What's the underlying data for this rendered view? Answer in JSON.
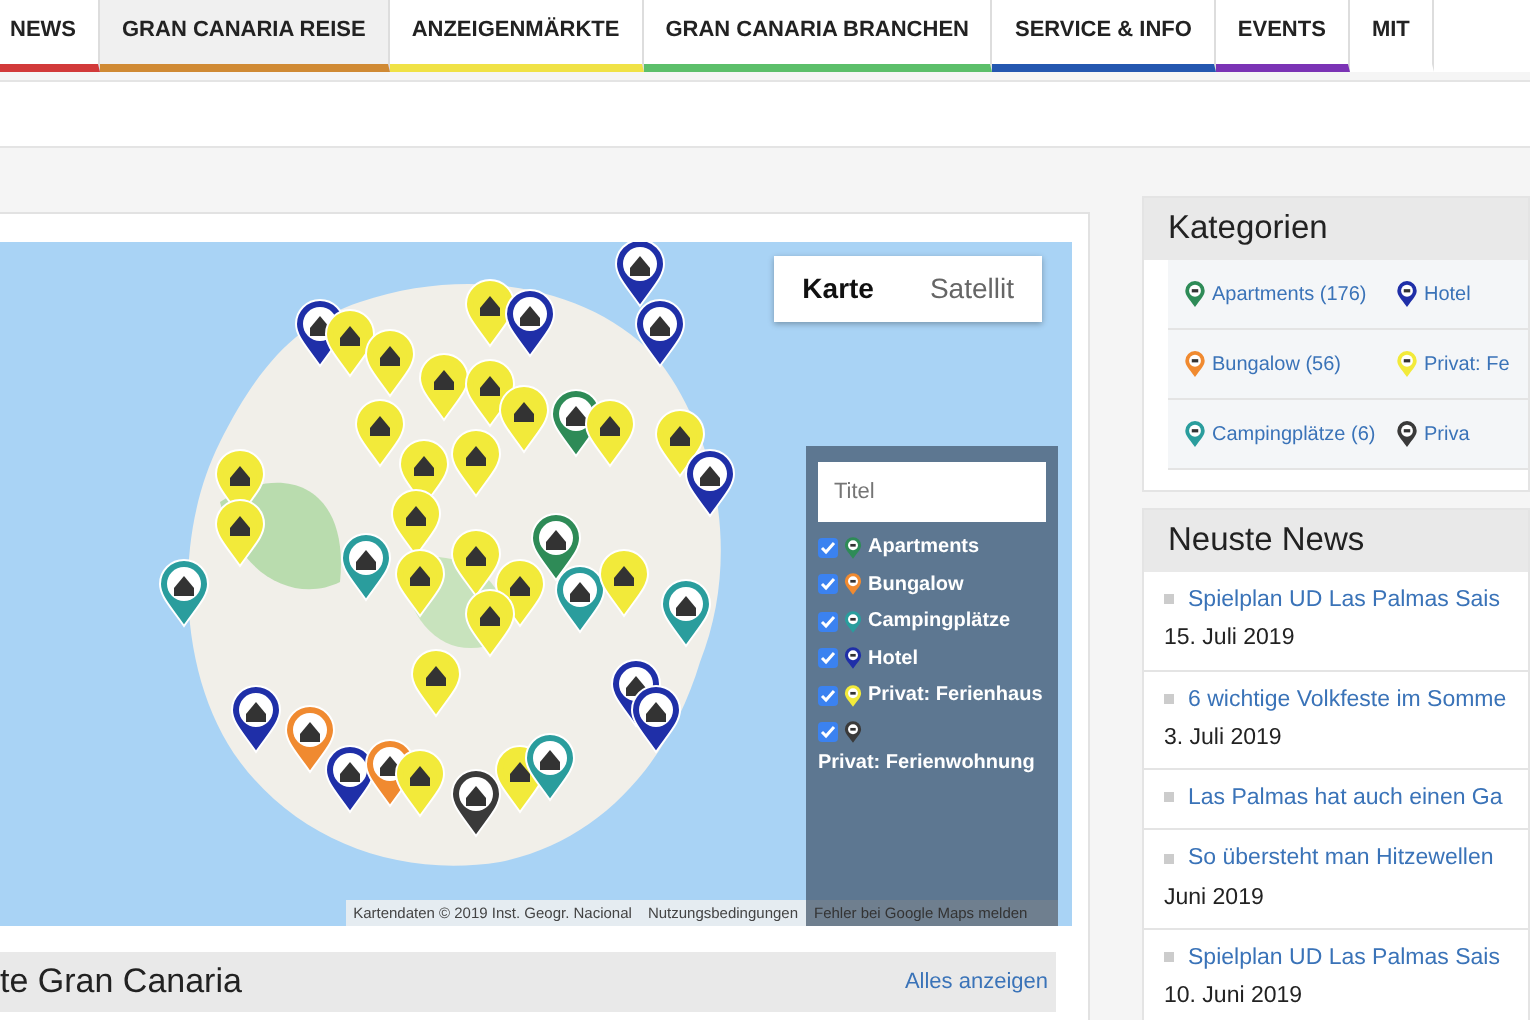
{
  "nav": [
    {
      "label": "NEWS",
      "color": "#d23a3a",
      "selected": false
    },
    {
      "label": "GRAN CANARIA REISE",
      "color": "#d08a34",
      "selected": true
    },
    {
      "label": "ANZEIGENMÄRKTE",
      "color": "#f0e246",
      "selected": false
    },
    {
      "label": "GRAN CANARIA BRANCHEN",
      "color": "#5cbf6a",
      "selected": false
    },
    {
      "label": "SERVICE & INFO",
      "color": "#2457b0",
      "selected": false
    },
    {
      "label": "EVENTS",
      "color": "#7b33b5",
      "selected": false
    },
    {
      "label": "MIT",
      "color": "#ffffff",
      "selected": false
    }
  ],
  "map": {
    "map_types": [
      {
        "label": "Karte",
        "selected": true
      },
      {
        "label": "Satellit",
        "selected": false
      }
    ],
    "legend": {
      "placeholder": "Titel",
      "items": [
        {
          "label": "Apartments",
          "checked": true,
          "color": "#2e8b57"
        },
        {
          "label": "Bungalow",
          "checked": true,
          "color": "#f08a30"
        },
        {
          "label": "Campingplätze",
          "checked": true,
          "color": "#2a9d9d"
        },
        {
          "label": "Hotel",
          "checked": true,
          "color": "#1f2fa8"
        },
        {
          "label": "Privat: Ferienhaus",
          "checked": true,
          "color": "#f2ea3a"
        },
        {
          "label": "Privat: Ferienwohnung",
          "checked": true,
          "color": "#3a3a3a"
        }
      ]
    },
    "attribution": "Kartendaten © 2019 Inst. Geogr. Nacional",
    "terms": "Nutzungsbedingungen",
    "report": "Fehler bei Google Maps melden"
  },
  "section": {
    "title": "te Gran Canaria",
    "link": "Alles anzeigen"
  },
  "categories": {
    "title": "Kategorien",
    "items": [
      {
        "label": "Apartments (176)",
        "color": "#2e8b57"
      },
      {
        "label": "Hotel",
        "color": "#1f2fa8"
      },
      {
        "label": "Bungalow (56)",
        "color": "#f08a30"
      },
      {
        "label": "Privat: Fe",
        "color": "#f2ea3a"
      },
      {
        "label": "Campingplätze (6)",
        "color": "#2a9d9d"
      },
      {
        "label": "Priva",
        "color": "#3a3a3a"
      }
    ]
  },
  "news": {
    "title": "Neuste News",
    "items": [
      {
        "title": "Spielplan UD Las Palmas Sais",
        "date": "15. Juli 2019"
      },
      {
        "title": "6 wichtige Volkfeste im Somme",
        "date": "3. Juli 2019"
      },
      {
        "title": "Las Palmas hat auch einen Ga"
      },
      {
        "title": "So übersteht man Hitzewellen",
        "date": "Juni 2019"
      },
      {
        "title": "Spielplan UD Las Palmas Sais",
        "date": "10. Juni 2019"
      }
    ]
  }
}
